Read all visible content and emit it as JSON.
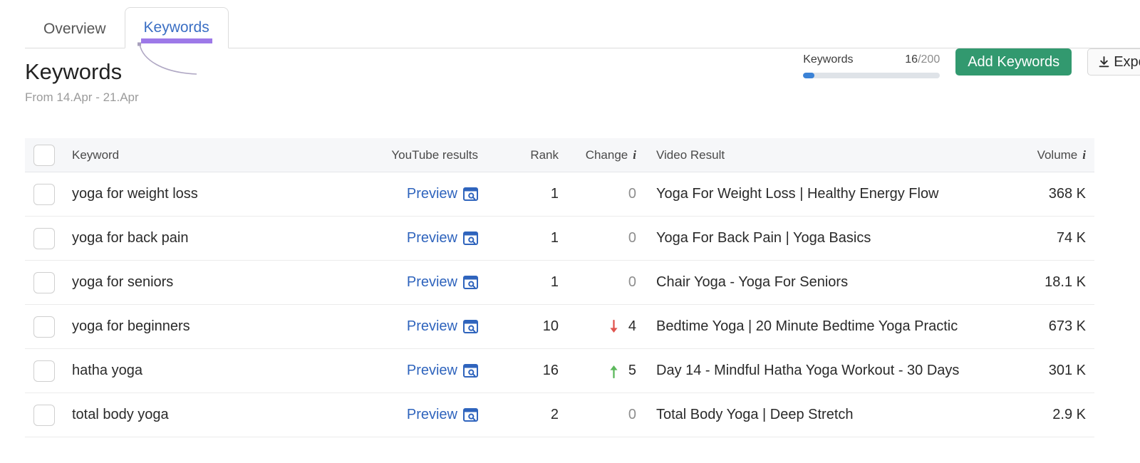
{
  "tabs": [
    {
      "label": "Overview",
      "active": false
    },
    {
      "label": "Keywords",
      "active": true
    }
  ],
  "header": {
    "title": "Keywords",
    "date_range": "From 14.Apr - 21.Apr"
  },
  "toolbar": {
    "quota_label": "Keywords",
    "quota_used": "16",
    "quota_total": "/200",
    "quota_percent": 8,
    "add_keywords_label": "Add Keywords",
    "export_label": "Export",
    "export_icon": "download-icon",
    "add_button_color": "#32996f",
    "progress_color": "#3b82d6"
  },
  "table": {
    "columns": [
      {
        "key": "select",
        "label": ""
      },
      {
        "key": "keyword",
        "label": "Keyword"
      },
      {
        "key": "yt",
        "label": "YouTube results"
      },
      {
        "key": "rank",
        "label": "Rank"
      },
      {
        "key": "change",
        "label": "Change",
        "info": true
      },
      {
        "key": "video",
        "label": "Video Result"
      },
      {
        "key": "volume",
        "label": "Volume",
        "info": true
      }
    ],
    "preview_label": "Preview",
    "preview_icon": "window-search-icon",
    "rows": [
      {
        "keyword": "yoga for weight loss",
        "rank": "1",
        "change": "0",
        "change_dir": "none",
        "video": "Yoga For Weight Loss | Healthy Energy Flow",
        "volume": "368 K"
      },
      {
        "keyword": "yoga for back pain",
        "rank": "1",
        "change": "0",
        "change_dir": "none",
        "video": "Yoga For Back Pain | Yoga Basics",
        "volume": "74 K"
      },
      {
        "keyword": "yoga for seniors",
        "rank": "1",
        "change": "0",
        "change_dir": "none",
        "video": "Chair Yoga - Yoga For Seniors",
        "volume": "18.1 K"
      },
      {
        "keyword": "yoga for beginners",
        "rank": "10",
        "change": "4",
        "change_dir": "down",
        "video": "Bedtime Yoga | 20 Minute Bedtime Yoga Practic",
        "volume": "673 K"
      },
      {
        "keyword": "hatha yoga",
        "rank": "16",
        "change": "5",
        "change_dir": "up",
        "video": "Day 14 - Mindful Hatha Yoga Workout - 30 Days",
        "volume": "301 K"
      },
      {
        "keyword": "total body yoga",
        "rank": "2",
        "change": "0",
        "change_dir": "none",
        "video": "Total Body Yoga | Deep Stretch",
        "volume": "2.9 K"
      }
    ]
  },
  "colors": {
    "accent_purple": "#9d79e8",
    "link_blue": "#2f64bd",
    "change_up": "#5cb85c",
    "change_down": "#e0554f",
    "header_bg": "#f6f7f9"
  }
}
